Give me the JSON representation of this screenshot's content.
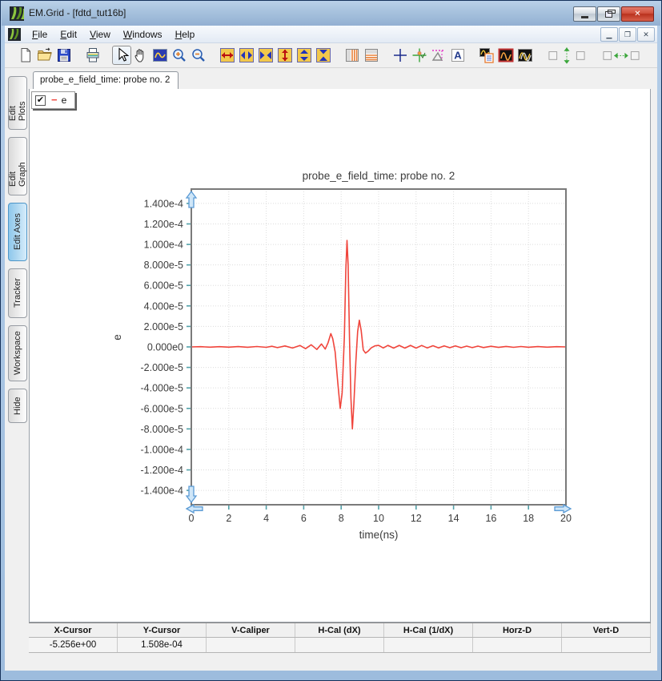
{
  "window": {
    "title": "EM.Grid - [fdtd_tut16b]"
  },
  "menu": {
    "items": [
      "File",
      "Edit",
      "View",
      "Windows",
      "Help"
    ]
  },
  "toolbar": {
    "icons": [
      "new-file",
      "open-file",
      "save",
      "|",
      "print",
      "|",
      "select-cursor",
      "pan-hand",
      "zoom-region",
      "zoom-in",
      "zoom-out",
      "|",
      "expand-x-red",
      "widen-x",
      "narrow-x",
      "expand-y-red",
      "widen-y",
      "narrow-y",
      "|",
      "vertical-bars",
      "horizontal-bars",
      "|",
      "crosshair-plus",
      "tracker-crosshair",
      "caliper-triangle",
      "text-annotation",
      "|",
      "graph-with-legend",
      "single-trace",
      "dual-trace",
      "|",
      "fit-vertical-toggle",
      "|",
      "fit-horizontal-toggle"
    ],
    "pressed_icon": "select-cursor"
  },
  "sidebar": {
    "tabs": [
      {
        "label": "Edit Plots",
        "active": false
      },
      {
        "label": "Edit Graph",
        "active": false
      },
      {
        "label": "Edit Axes",
        "active": true
      },
      {
        "label": "Tracker",
        "active": false
      },
      {
        "label": "Workspace",
        "active": false
      },
      {
        "label": "Hide",
        "active": false
      }
    ]
  },
  "document": {
    "tab_label": "probe_e_field_time: probe no. 2",
    "legend": {
      "checked": true,
      "check_glyph": "✔",
      "dash_glyph": "−",
      "series_label": "e",
      "line_color": "#f0453c"
    }
  },
  "chart_data": {
    "type": "line",
    "title": "probe_e_field_time: probe no. 2",
    "xlabel": "time(ns)",
    "ylabel": "e",
    "xlim": [
      0,
      20
    ],
    "ylim": [
      -0.000154,
      0.000154
    ],
    "grid": true,
    "xticks": [
      0,
      2,
      4,
      6,
      8,
      10,
      12,
      14,
      16,
      18,
      20
    ],
    "yticks": [
      {
        "value": 0.00014,
        "label": "1.400e-4"
      },
      {
        "value": 0.00012,
        "label": "1.200e-4"
      },
      {
        "value": 0.0001,
        "label": "1.000e-4"
      },
      {
        "value": 8e-05,
        "label": "8.000e-5"
      },
      {
        "value": 6e-05,
        "label": "6.000e-5"
      },
      {
        "value": 4e-05,
        "label": "4.000e-5"
      },
      {
        "value": 2e-05,
        "label": "2.000e-5"
      },
      {
        "value": 0.0,
        "label": "0.000e0"
      },
      {
        "value": -2e-05,
        "label": "-2.000e-5"
      },
      {
        "value": -4e-05,
        "label": "-4.000e-5"
      },
      {
        "value": -6e-05,
        "label": "-6.000e-5"
      },
      {
        "value": -8e-05,
        "label": "-8.000e-5"
      },
      {
        "value": -0.0001,
        "label": "-1.000e-4"
      },
      {
        "value": -0.00012,
        "label": "-1.200e-4"
      },
      {
        "value": -0.00014,
        "label": "-1.400e-4"
      }
    ],
    "series": [
      {
        "name": "e",
        "color": "#f0453c",
        "points": [
          [
            0,
            0
          ],
          [
            0.5,
            2e-07
          ],
          [
            1,
            -2e-07
          ],
          [
            1.5,
            2e-07
          ],
          [
            2,
            -2e-07
          ],
          [
            2.5,
            3e-07
          ],
          [
            3,
            -3e-07
          ],
          [
            3.5,
            4e-07
          ],
          [
            4,
            -4e-07
          ],
          [
            4.3,
            6e-07
          ],
          [
            4.6,
            -7e-07
          ],
          [
            5,
            9e-07
          ],
          [
            5.4,
            -1.1e-06
          ],
          [
            5.8,
            1.4e-06
          ],
          [
            6.1,
            -1.7e-06
          ],
          [
            6.4,
            2.1e-06
          ],
          [
            6.7,
            -2.5e-06
          ],
          [
            6.95,
            2.9e-06
          ],
          [
            7.15,
            -2.1e-06
          ],
          [
            7.3,
            4e-06
          ],
          [
            7.45,
            1.3e-05
          ],
          [
            7.55,
            8e-06
          ],
          [
            7.68,
            -5e-06
          ],
          [
            7.82,
            -3.5e-05
          ],
          [
            7.95,
            -6e-05
          ],
          [
            8.05,
            -4.5e-05
          ],
          [
            8.17,
            1e-05
          ],
          [
            8.25,
            7.5e-05
          ],
          [
            8.31,
            0.000104
          ],
          [
            8.37,
            8e-05
          ],
          [
            8.45,
            5e-06
          ],
          [
            8.52,
            -5e-05
          ],
          [
            8.6,
            -8e-05
          ],
          [
            8.68,
            -5.5e-05
          ],
          [
            8.78,
            -1.5e-05
          ],
          [
            8.88,
            1.5e-05
          ],
          [
            8.97,
            2.6e-05
          ],
          [
            9.07,
            1.6e-05
          ],
          [
            9.18,
            -3e-06
          ],
          [
            9.3,
            -6e-06
          ],
          [
            9.45,
            -4e-06
          ],
          [
            9.6,
            -1e-06
          ],
          [
            9.8,
            1e-06
          ],
          [
            10,
            1.5e-06
          ],
          [
            10.25,
            -1e-06
          ],
          [
            10.5,
            1.5e-06
          ],
          [
            10.8,
            -1.2e-06
          ],
          [
            11.1,
            1.5e-06
          ],
          [
            11.4,
            -1.2e-06
          ],
          [
            11.7,
            1.5e-06
          ],
          [
            12,
            -1.2e-06
          ],
          [
            12.3,
            1.4e-06
          ],
          [
            12.6,
            -1e-06
          ],
          [
            12.9,
            1.2e-06
          ],
          [
            13.2,
            -1e-06
          ],
          [
            13.5,
            1e-06
          ],
          [
            13.8,
            -8e-07
          ],
          [
            14.1,
            1e-06
          ],
          [
            14.4,
            -8e-07
          ],
          [
            14.7,
            8e-07
          ],
          [
            15,
            -7e-07
          ],
          [
            15.3,
            8e-07
          ],
          [
            15.6,
            -6e-07
          ],
          [
            16,
            6e-07
          ],
          [
            16.4,
            -5e-07
          ],
          [
            16.8,
            5e-07
          ],
          [
            17.2,
            -4e-07
          ],
          [
            17.6,
            4e-07
          ],
          [
            18,
            -3e-07
          ],
          [
            18.5,
            3e-07
          ],
          [
            19,
            -2e-07
          ],
          [
            19.5,
            2e-07
          ],
          [
            20,
            0
          ]
        ]
      }
    ],
    "colors": {
      "grid": "#dcdcdc",
      "frame": "#7a7a7a",
      "tick": "#52a0a8",
      "text": "#3c3c3c",
      "handle_fill": "#cfe6f8",
      "handle_stroke": "#5b9bd5"
    }
  },
  "status_bar": {
    "headers": [
      "X-Cursor",
      "Y-Cursor",
      "V-Caliper",
      "H-Cal (dX)",
      "H-Cal (1/dX)",
      "Horz-D",
      "Vert-D"
    ],
    "values": [
      "-5.256e+00",
      "1.508e-04",
      "",
      "",
      "",
      "",
      ""
    ]
  }
}
